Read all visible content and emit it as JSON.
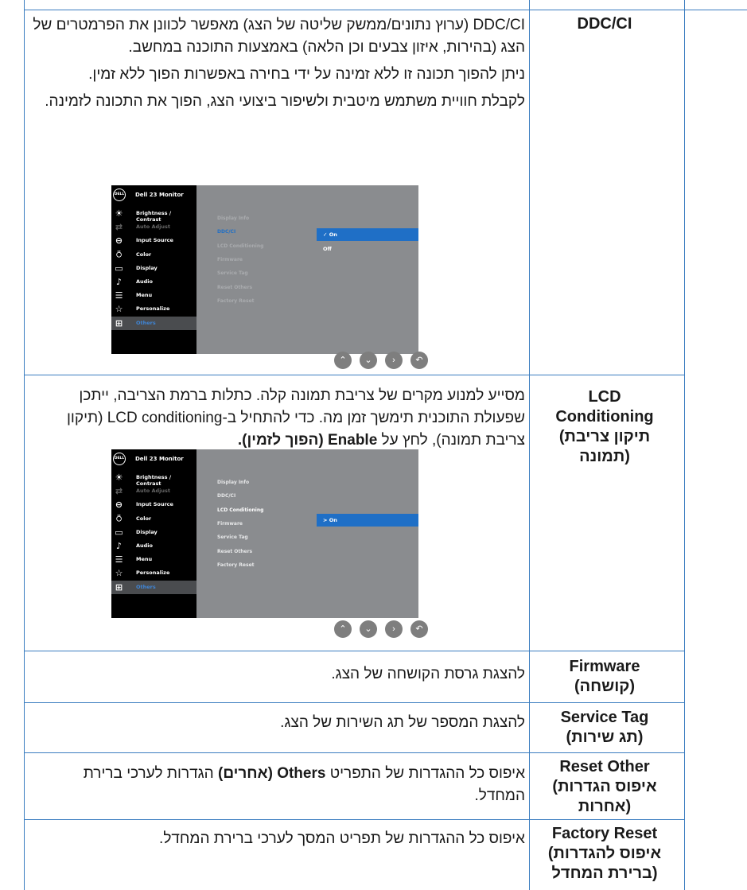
{
  "rows": [
    {
      "title": [
        "DDC/CI"
      ],
      "paragraphs": [
        "DDC/CI (ערוץ נתונים/ממשק שליטה של הצג) מאפשר לכוונן את הפרמטרים של הצג (בהירות, איזון צבעים וכן הלאה) באמצעות התוכנה במחשב.",
        "ניתן להפוך תכונה זו ללא זמינה על ידי בחירה באפשרות הפוך ללא זמין.",
        "לקבלת חוויית משתמש מיטבית ולשיפור ביצועי הצג, הפוך את התכונה לזמינה."
      ]
    },
    {
      "title": [
        "LCD",
        "Conditioning",
        "(תיקון צריבת",
        "תמונה)"
      ],
      "paragraphs": [
        "מסייע למנוע מקרים של צריבת תמונה קלה. כתלות ברמת הצריבה, ייתכן שפעולת התוכנית תימשך זמן מה. כדי להתחיל ב-LCD conditioning (תיקון צריבת תמונה), לחץ על <b>Enable (הפוך לזמין).</b>"
      ]
    },
    {
      "title": [
        "Firmware",
        "(קושחה)"
      ],
      "paragraphs": [
        "להצגת גרסת הקושחה של הצג."
      ]
    },
    {
      "title": [
        "Service Tag",
        "(תג שירות)"
      ],
      "paragraphs": [
        "להצגת המספר של תג השירות של הצג."
      ]
    },
    {
      "title": [
        "Reset Other",
        "(איפוס הגדרות",
        "אחרות)"
      ],
      "paragraphs": [
        "איפוס כל ההגדרות של התפריט <b>Others (אחרים)</b> הגדרות לערכי ברירת המחדל."
      ]
    },
    {
      "title": [
        "Factory Reset",
        "(איפוס להגדרות",
        "ברירת המחדל)"
      ],
      "paragraphs": [
        "איפוס כל ההגדרות של תפריט המסך לערכי ברירת המחדל."
      ]
    }
  ],
  "osd": {
    "logo": "DELL",
    "monitor_name": "Dell 23 Monitor",
    "menu": [
      {
        "icon": "brightness-icon",
        "glyph": "☀",
        "label": "Brightness / Contrast",
        "dim": false
      },
      {
        "icon": "auto-adjust-icon",
        "glyph": "⇄",
        "label": "Auto Adjust",
        "dim": true
      },
      {
        "icon": "input-source-icon",
        "glyph": "⊖",
        "label": "Input Source",
        "dim": false
      },
      {
        "icon": "color-icon",
        "glyph": "⍥",
        "label": "Color",
        "dim": false
      },
      {
        "icon": "display-icon",
        "glyph": "▭",
        "label": "Display",
        "dim": false
      },
      {
        "icon": "audio-icon",
        "glyph": "♪",
        "label": "Audio",
        "dim": false
      },
      {
        "icon": "menu-icon",
        "glyph": "☰",
        "label": "Menu",
        "dim": false
      },
      {
        "icon": "personalize-icon",
        "glyph": "☆",
        "label": "Personalize",
        "dim": false
      },
      {
        "icon": "others-icon",
        "glyph": "⊞",
        "label": "Others",
        "dim": false,
        "selected": true
      }
    ],
    "submenu": [
      "Display Info",
      "DDC/CI",
      "LCD Conditioning",
      "Firmware",
      "Service Tag",
      "Reset Others",
      "Factory Reset"
    ],
    "screen1": {
      "selected_sub": 1,
      "options": [
        {
          "label": "On",
          "marker": "✓",
          "selected": true
        },
        {
          "label": "Off",
          "marker": "",
          "selected": false
        }
      ]
    },
    "screen2": {
      "selected_sub": 2,
      "options": [
        {
          "label": "On",
          "marker": ">",
          "selected": true
        }
      ]
    },
    "nav_buttons": [
      {
        "icon": "up-icon",
        "glyph": "⌃"
      },
      {
        "icon": "down-icon",
        "glyph": "⌄"
      },
      {
        "icon": "next-icon",
        "glyph": "›"
      },
      {
        "icon": "back-icon",
        "glyph": "↶"
      }
    ]
  }
}
